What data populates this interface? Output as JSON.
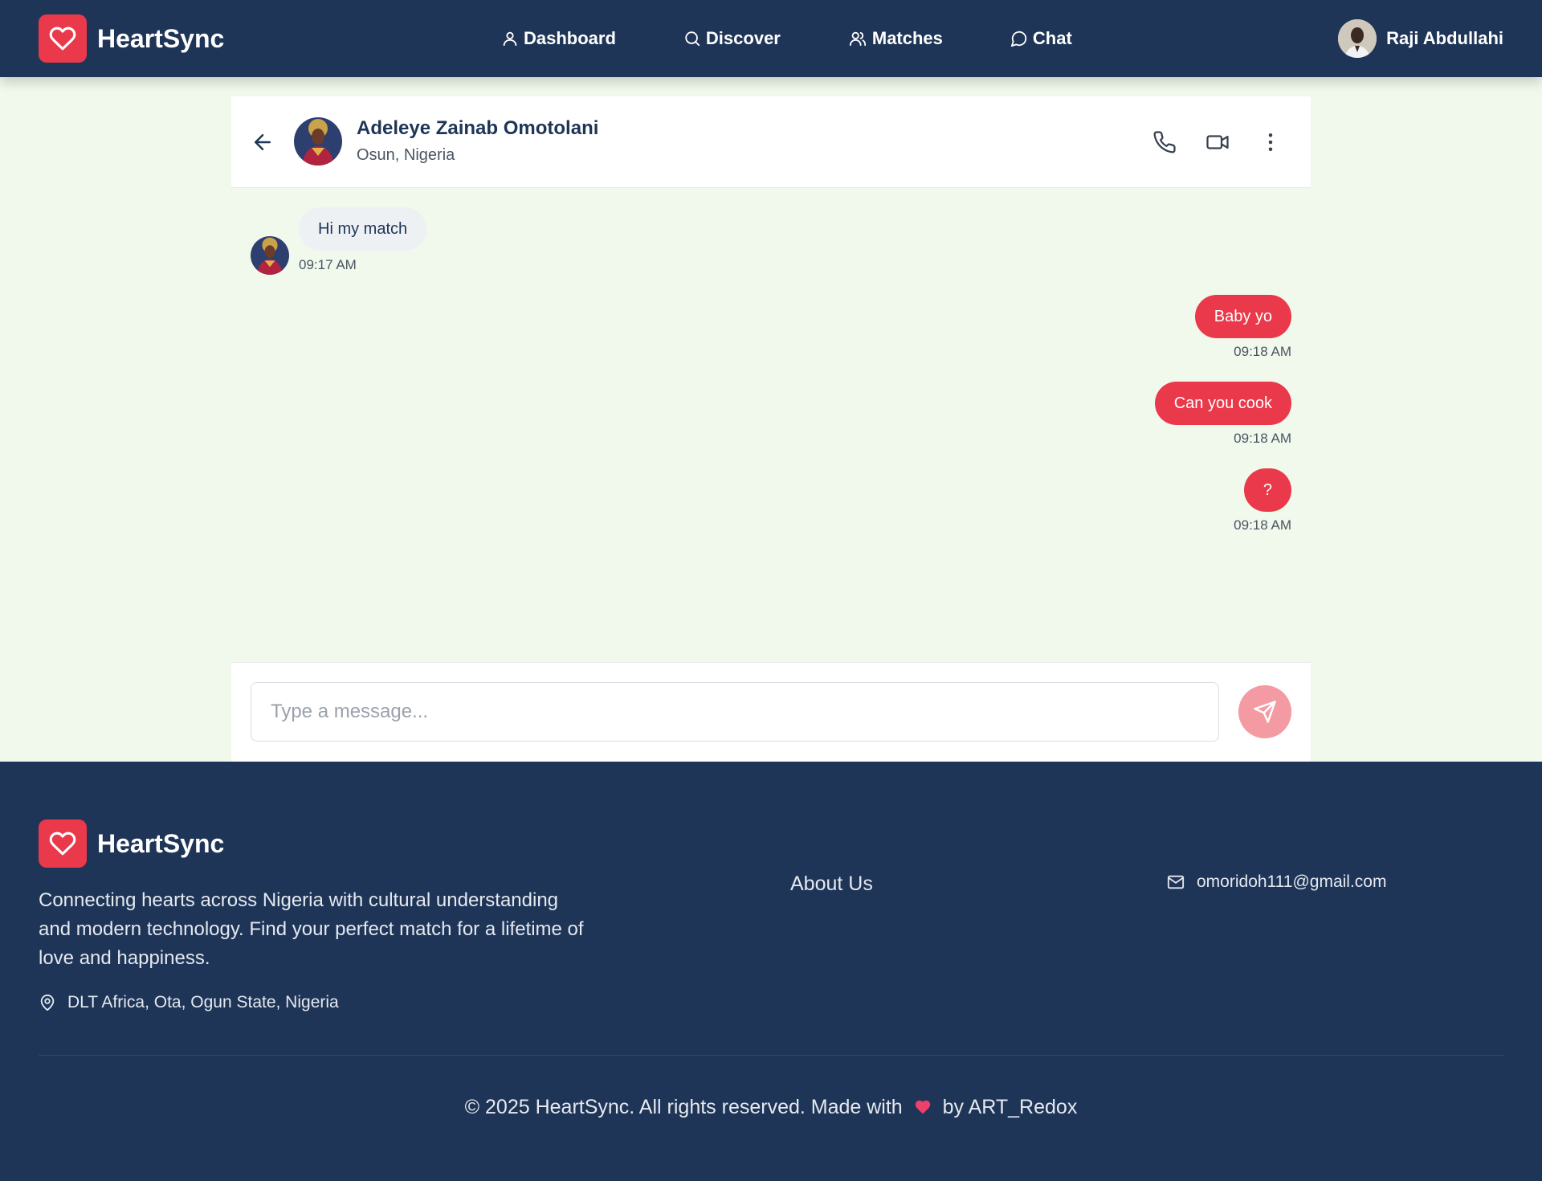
{
  "brand": {
    "name": "HeartSync",
    "color": "#e9394a",
    "logo_icon": "heart-icon"
  },
  "nav": {
    "items": [
      {
        "label": "Dashboard",
        "icon": "user-icon"
      },
      {
        "label": "Discover",
        "icon": "search-icon"
      },
      {
        "label": "Matches",
        "icon": "users-icon"
      },
      {
        "label": "Chat",
        "icon": "chat-bubble-icon"
      }
    ]
  },
  "user": {
    "name": "Raji Abdullahi"
  },
  "chat": {
    "contact_name": "Adeleye Zainab Omotolani",
    "contact_location": "Osun, Nigeria",
    "actions": [
      "phone-icon",
      "video-icon",
      "more-vertical-icon"
    ],
    "messages": [
      {
        "direction": "in",
        "text": "Hi my match",
        "time": "09:17 AM"
      },
      {
        "direction": "out",
        "text": "Baby yo",
        "time": "09:18 AM"
      },
      {
        "direction": "out",
        "text": "Can you cook",
        "time": "09:18 AM"
      },
      {
        "direction": "out",
        "text": "?",
        "time": "09:18 AM"
      }
    ],
    "input_placeholder": "Type a message..."
  },
  "footer": {
    "brand": "HeartSync",
    "tagline": "Connecting hearts across Nigeria with cultural understanding and modern technology. Find your perfect match for a lifetime of love and happiness.",
    "address": "DLT Africa, Ota, Ogun State, Nigeria",
    "about_link": "About Us",
    "email": "omoridoh111@gmail.com",
    "copyright_prefix": "© 2025 HeartSync. All rights reserved. Made with",
    "copyright_suffix": "by ART_Redox"
  },
  "colors": {
    "navy": "#1e3557",
    "accent": "#e9394a",
    "background": "#f0f9ec"
  }
}
